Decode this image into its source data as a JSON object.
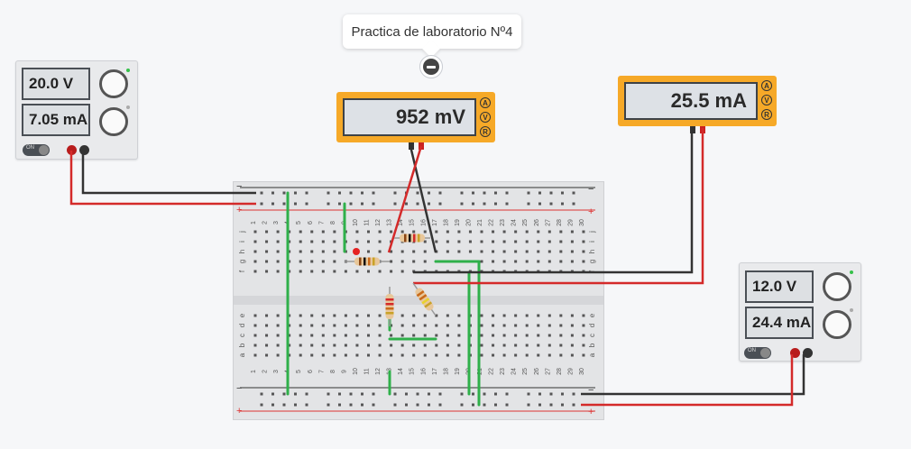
{
  "tooltip": {
    "title": "Practica de laboratorio Nº4"
  },
  "psu_left": {
    "voltage": "20.0 V",
    "current": "7.05 mA",
    "on_label": "ON"
  },
  "psu_right": {
    "voltage": "12.0 V",
    "current": "24.4 mA",
    "on_label": "ON"
  },
  "voltmeter": {
    "reading": "952 mV",
    "modes": [
      "A",
      "V",
      "R"
    ]
  },
  "ammeter": {
    "reading": "25.5 mA",
    "modes": [
      "A",
      "V",
      "R"
    ]
  },
  "breadboard": {
    "rail_plus": "+",
    "rail_minus": "−",
    "columns": [
      "1",
      "2",
      "3",
      "4",
      "5",
      "6",
      "7",
      "8",
      "9",
      "10",
      "11",
      "12",
      "13",
      "14",
      "15",
      "16",
      "17",
      "18",
      "19",
      "20",
      "21",
      "22",
      "23",
      "24",
      "25",
      "26",
      "27",
      "28",
      "29",
      "30"
    ],
    "row_letters_top": [
      "j",
      "i",
      "h",
      "g",
      "f"
    ],
    "row_letters_bottom": [
      "e",
      "d",
      "c",
      "b",
      "a"
    ]
  },
  "colors": {
    "wire_red": "#d42a2a",
    "wire_black": "#333333",
    "wire_green": "#2fb04a",
    "meter_body": "#f6a928"
  }
}
